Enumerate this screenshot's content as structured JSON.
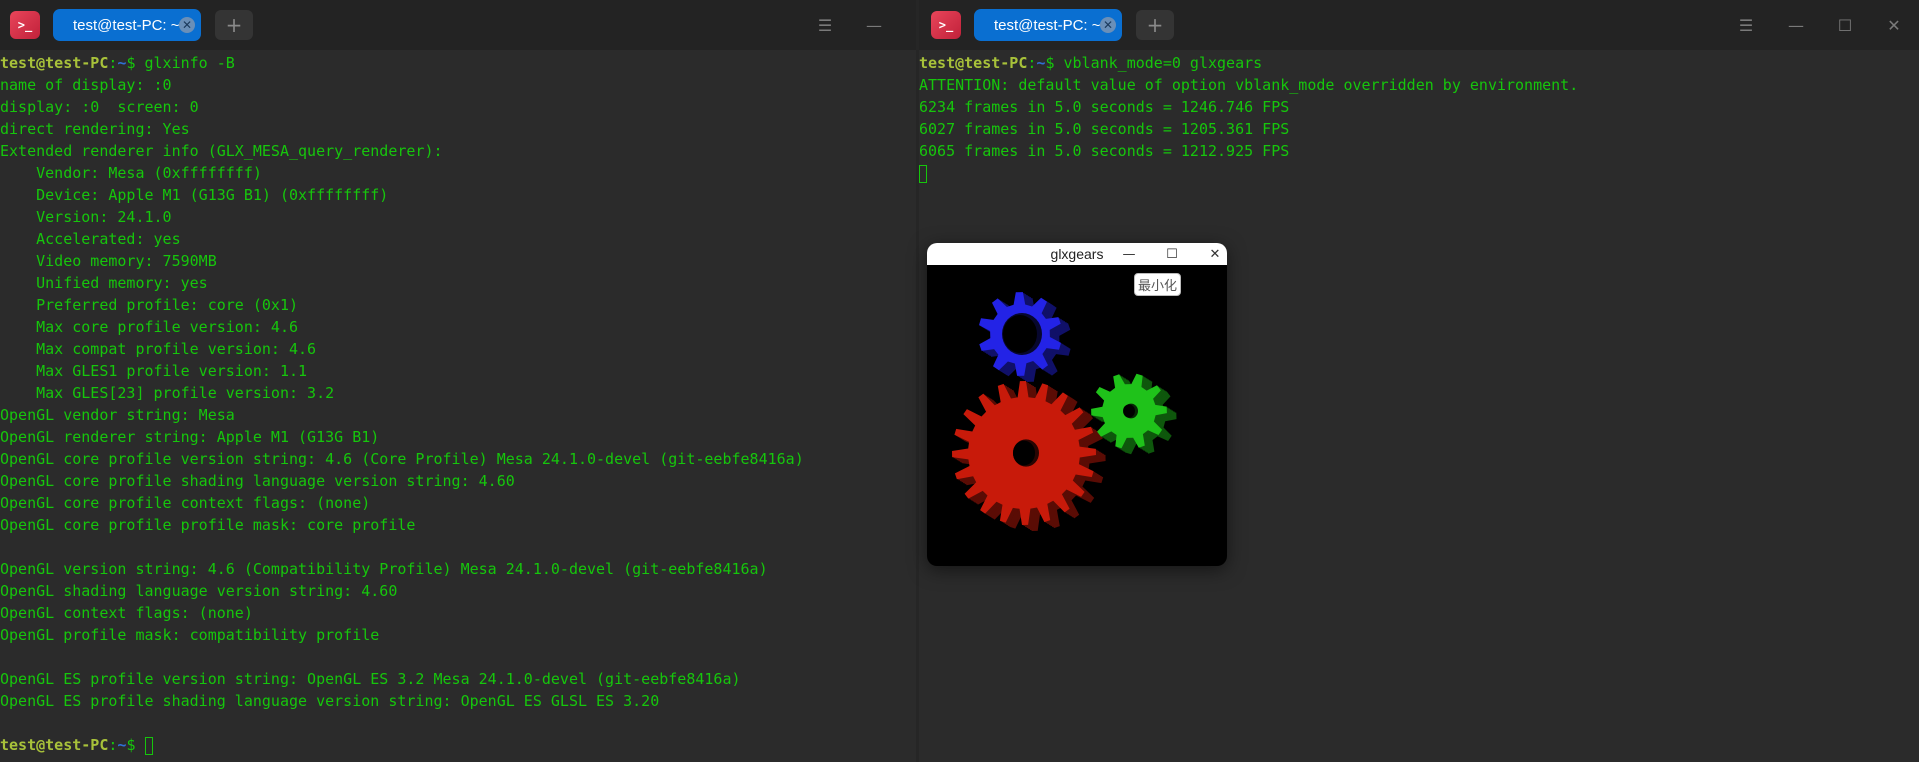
{
  "left_terminal": {
    "app_icon": ">_",
    "tab_title": "test@test-PC: ~",
    "new_tab_label": "+",
    "menu_icon": "menu-icon",
    "lines": [
      {
        "prompt": true,
        "user": "test@test-PC",
        "sep": ":",
        "dir": "~",
        "sym": "$ ",
        "cmd": "glxinfo -B"
      },
      {
        "text": "name of display: :0"
      },
      {
        "text": "display: :0  screen: 0"
      },
      {
        "text": "direct rendering: Yes"
      },
      {
        "text": "Extended renderer info (GLX_MESA_query_renderer):"
      },
      {
        "text": "    Vendor: Mesa (0xffffffff)"
      },
      {
        "text": "    Device: Apple M1 (G13G B1) (0xffffffff)"
      },
      {
        "text": "    Version: 24.1.0"
      },
      {
        "text": "    Accelerated: yes"
      },
      {
        "text": "    Video memory: 7590MB"
      },
      {
        "text": "    Unified memory: yes"
      },
      {
        "text": "    Preferred profile: core (0x1)"
      },
      {
        "text": "    Max core profile version: 4.6"
      },
      {
        "text": "    Max compat profile version: 4.6"
      },
      {
        "text": "    Max GLES1 profile version: 1.1"
      },
      {
        "text": "    Max GLES[23] profile version: 3.2"
      },
      {
        "text": "OpenGL vendor string: Mesa"
      },
      {
        "text": "OpenGL renderer string: Apple M1 (G13G B1)"
      },
      {
        "text": "OpenGL core profile version string: 4.6 (Core Profile) Mesa 24.1.0-devel (git-eebfe8416a)"
      },
      {
        "text": "OpenGL core profile shading language version string: 4.60"
      },
      {
        "text": "OpenGL core profile context flags: (none)"
      },
      {
        "text": "OpenGL core profile profile mask: core profile"
      },
      {
        "text": ""
      },
      {
        "text": "OpenGL version string: 4.6 (Compatibility Profile) Mesa 24.1.0-devel (git-eebfe8416a)"
      },
      {
        "text": "OpenGL shading language version string: 4.60"
      },
      {
        "text": "OpenGL context flags: (none)"
      },
      {
        "text": "OpenGL profile mask: compatibility profile"
      },
      {
        "text": ""
      },
      {
        "text": "OpenGL ES profile version string: OpenGL ES 3.2 Mesa 24.1.0-devel (git-eebfe8416a)"
      },
      {
        "text": "OpenGL ES profile shading language version string: OpenGL ES GLSL ES 3.20"
      },
      {
        "text": ""
      },
      {
        "prompt": true,
        "user": "test@test-PC",
        "sep": ":",
        "dir": "~",
        "sym": "$ ",
        "cmd": "",
        "cursor": true
      }
    ]
  },
  "right_terminal": {
    "app_icon": ">_",
    "tab_title": "test@test-PC: ~",
    "new_tab_label": "+",
    "lines": [
      {
        "prompt": true,
        "user": "test@test-PC",
        "sep": ":",
        "dir": "~",
        "sym": "$ ",
        "cmd": "vblank_mode=0 glxgears"
      },
      {
        "text": "ATTENTION: default value of option vblank_mode overridden by environment."
      },
      {
        "text": "6234 frames in 5.0 seconds = 1246.746 FPS"
      },
      {
        "text": "6027 frames in 5.0 seconds = 1205.361 FPS"
      },
      {
        "text": "6065 frames in 5.0 seconds = 1212.925 FPS"
      },
      {
        "cursor_only": true
      }
    ]
  },
  "glxgears_window": {
    "title": "glxgears",
    "minimize_tooltip": "最小化",
    "gear_colors": {
      "red": "#c81a0a",
      "green": "#1fc21a",
      "blue": "#2323e6"
    }
  },
  "colors": {
    "terminal_bg": "#2b2b2b",
    "titlebar_bg": "#232323",
    "text_green": "#16c60c",
    "prompt_user": "#a8c23a",
    "prompt_dir": "#2f6fd6",
    "tab_active": "#0a6fd1"
  }
}
